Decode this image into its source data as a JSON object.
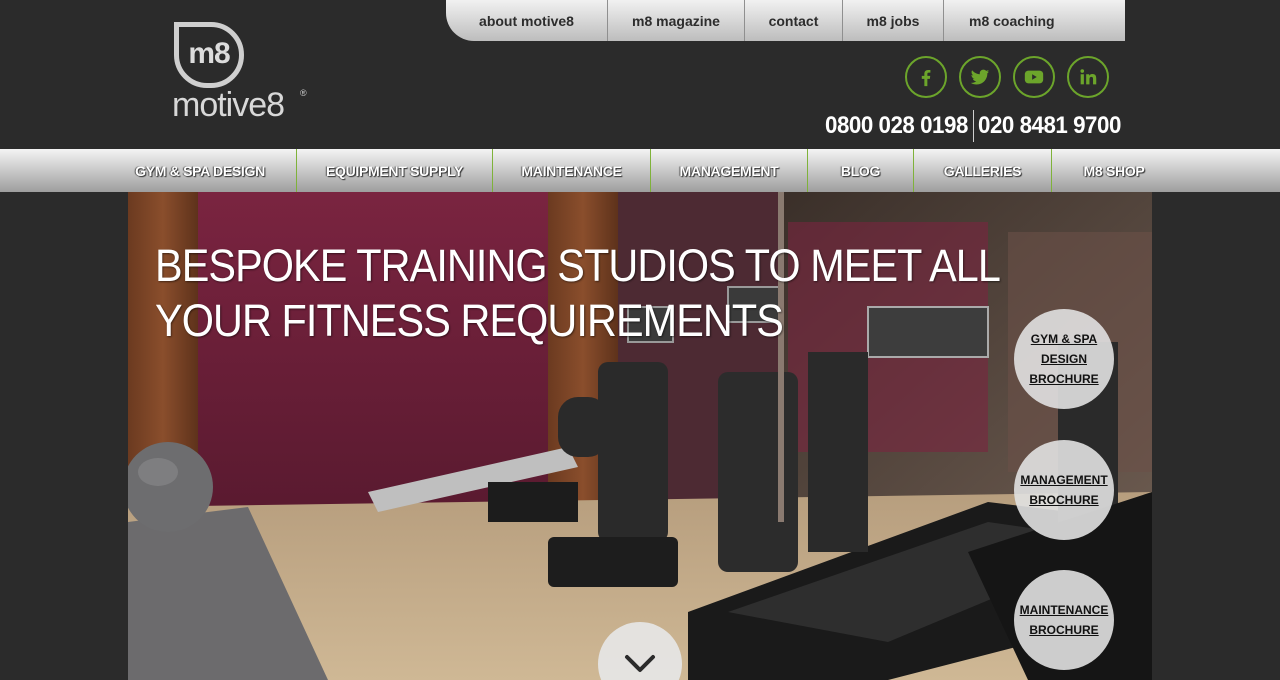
{
  "top_nav": [
    {
      "label": "about motive8"
    },
    {
      "label": "m8 magazine"
    },
    {
      "label": "contact"
    },
    {
      "label": "m8 jobs"
    },
    {
      "label": "m8 coaching"
    }
  ],
  "logo": {
    "mark": "m8",
    "word": "motive8",
    "reg": "®"
  },
  "social": [
    {
      "icon": "facebook-icon"
    },
    {
      "icon": "twitter-icon"
    },
    {
      "icon": "youtube-icon"
    },
    {
      "icon": "linkedin-icon"
    }
  ],
  "phones": [
    "0800 028 0198",
    "020 8481 9700"
  ],
  "main_nav": [
    {
      "label": "GYM & SPA DESIGN"
    },
    {
      "label": "EQUIPMENT SUPPLY"
    },
    {
      "label": "MAINTENANCE"
    },
    {
      "label": "MANAGEMENT"
    },
    {
      "label": "BLOG"
    },
    {
      "label": "GALLERIES"
    },
    {
      "label": "M8 SHOP"
    }
  ],
  "hero": {
    "title": "BESPOKE TRAINING STUDIOS TO MEET ALL YOUR FITNESS REQUIREMENTS",
    "brochures": [
      {
        "label": "GYM & SPA DESIGN BROCHURE"
      },
      {
        "label": "MANAGEMENT BROCHURE"
      },
      {
        "label": "MAINTENANCE BROCHURE"
      }
    ],
    "scroll_icon": "chevron-down-icon"
  },
  "colors": {
    "accent": "#6ca52b",
    "background": "#2b2b2b"
  }
}
